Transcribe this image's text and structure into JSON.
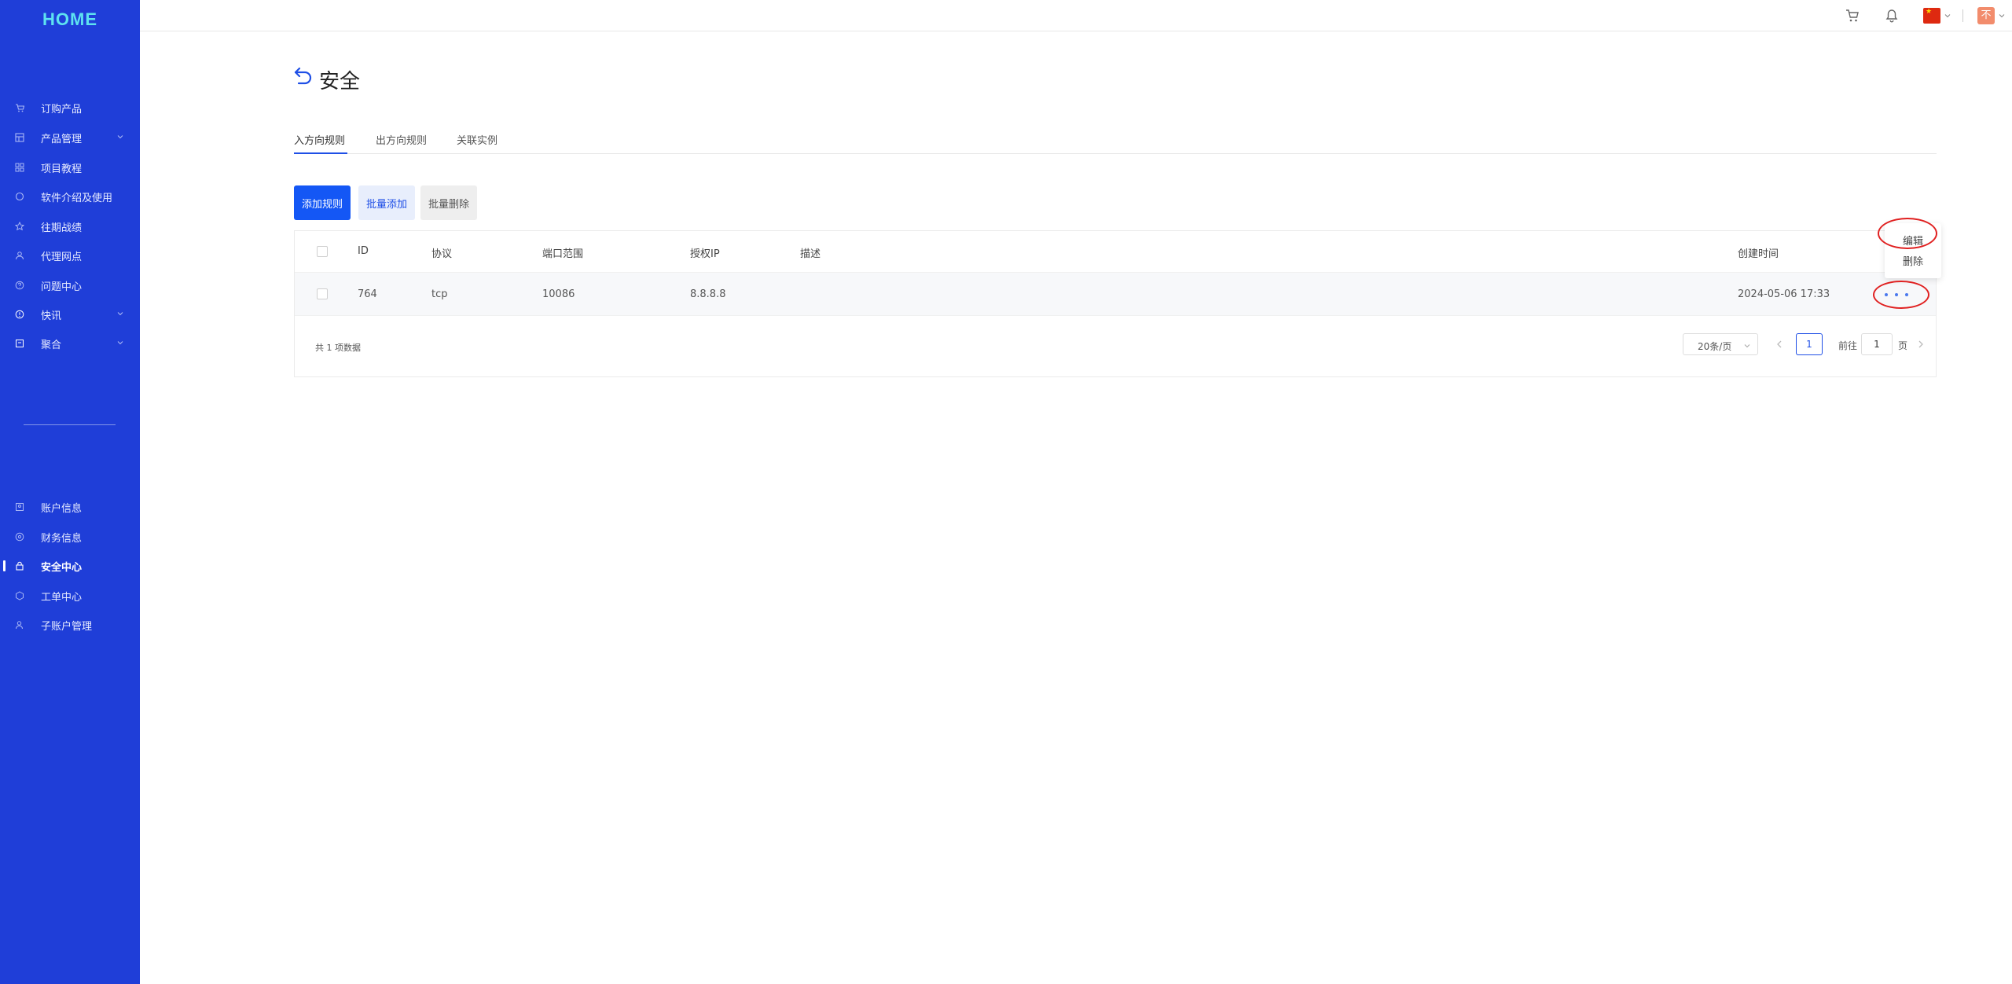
{
  "brand": {
    "logo": "HOME"
  },
  "sidebar": {
    "items": [
      {
        "label": "订购产品",
        "icon": "cart-icon",
        "expandable": false
      },
      {
        "label": "产品管理",
        "icon": "server-icon",
        "expandable": true
      },
      {
        "label": "项目教程",
        "icon": "grid-icon",
        "expandable": false
      },
      {
        "label": "软件介绍及使用",
        "icon": "circle-icon",
        "expandable": false
      },
      {
        "label": "往期战绩",
        "icon": "star-icon",
        "expandable": false
      },
      {
        "label": "代理网点",
        "icon": "agent-icon",
        "expandable": false
      },
      {
        "label": "问题中心",
        "icon": "help-icon",
        "expandable": false
      },
      {
        "label": "快讯",
        "icon": "alert-icon",
        "expandable": true
      },
      {
        "label": "聚合",
        "icon": "calendar-icon",
        "expandable": true
      }
    ],
    "bottom_items": [
      {
        "label": "账户信息",
        "icon": "account-icon"
      },
      {
        "label": "财务信息",
        "icon": "finance-icon"
      },
      {
        "label": "安全中心",
        "icon": "lock-icon",
        "active": true
      },
      {
        "label": "工单中心",
        "icon": "ticket-icon"
      },
      {
        "label": "子账户管理",
        "icon": "subaccount-icon"
      }
    ]
  },
  "topbar": {
    "avatar_text": "不"
  },
  "page": {
    "title": "安全",
    "tabs": [
      "入方向规则",
      "出方向规则",
      "关联实例"
    ],
    "active_tab": 0
  },
  "toolbar": {
    "add_rule": "添加规则",
    "batch_add": "批量添加",
    "batch_delete": "批量删除"
  },
  "table": {
    "columns": [
      "ID",
      "协议",
      "端口范围",
      "授权IP",
      "描述",
      "创建时间"
    ],
    "rows": [
      {
        "id": "764",
        "protocol": "tcp",
        "port_range": "10086",
        "ip": "8.8.8.8",
        "desc": "",
        "created": "2024-05-06 17:33"
      }
    ],
    "row_menu": [
      "编辑",
      "删除"
    ]
  },
  "pagination": {
    "total_text": "共 1 项数据",
    "page_size": "20条/页",
    "current_page": "1",
    "goto_label": "前往",
    "goto_value": "1",
    "page_unit": "页"
  },
  "colors": {
    "sidebar_bg": "#1f3ed8",
    "primary": "#1457f5",
    "annotation": "#e02020"
  }
}
